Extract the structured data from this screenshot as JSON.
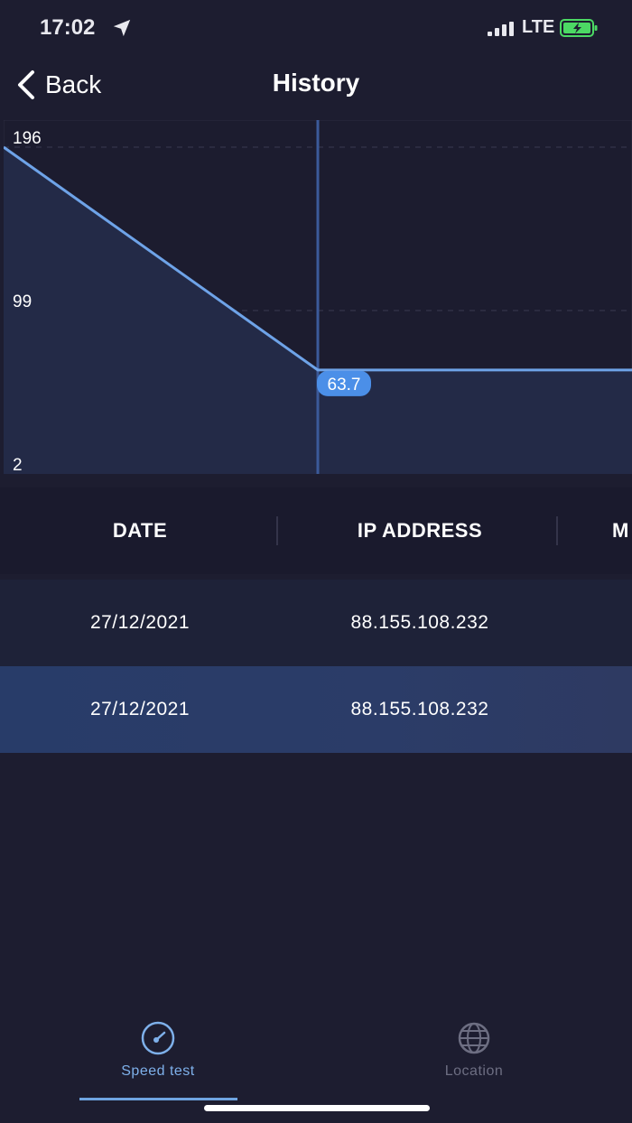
{
  "status_bar": {
    "time": "17:02",
    "network": "LTE",
    "battery_color": "#4cd964"
  },
  "nav": {
    "back_label": "Back",
    "title": "History"
  },
  "chart_data": {
    "type": "area",
    "y_ticks": [
      "196",
      "99",
      "2"
    ],
    "ylim": [
      2,
      196
    ],
    "series": [
      {
        "values": [
          196,
          63.7,
          63.7
        ]
      }
    ],
    "selected_point": {
      "index": 1,
      "label": "63.7"
    },
    "line_color": "#6ea3e8",
    "fill_color": "#232a47",
    "grid": "dashed horizontal"
  },
  "table": {
    "headers": [
      "DATE",
      "IP ADDRESS",
      "M"
    ],
    "rows": [
      {
        "date": "27/12/2021",
        "ip": "88.155.108.232"
      },
      {
        "date": "27/12/2021",
        "ip": "88.155.108.232"
      }
    ],
    "selected_row": 1
  },
  "tabs": [
    {
      "label": "Speed test",
      "icon": "speedometer-icon",
      "active": true
    },
    {
      "label": "Location",
      "icon": "globe-icon",
      "active": false
    }
  ]
}
